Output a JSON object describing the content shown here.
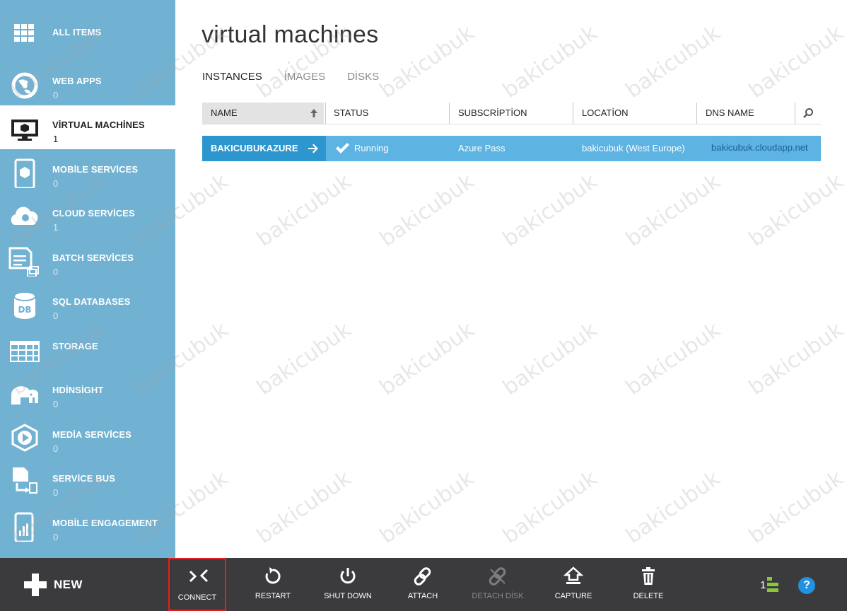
{
  "sidebar": {
    "items": [
      {
        "label": "ALL ITEMS",
        "count": "",
        "icon": "grid-icon"
      },
      {
        "label": "WEB APPS",
        "count": "0",
        "icon": "web-apps-icon"
      },
      {
        "label": "VİRTUAL MACHİNES",
        "count": "1",
        "icon": "monitor-icon"
      },
      {
        "label": "MOBİLE SERVİCES",
        "count": "0",
        "icon": "mobile-icon"
      },
      {
        "label": "CLOUD SERVİCES",
        "count": "1",
        "icon": "cloud-gear-icon"
      },
      {
        "label": "BATCH SERVİCES",
        "count": "0",
        "icon": "batch-icon"
      },
      {
        "label": "SQL DATABASES",
        "count": "0",
        "icon": "database-icon"
      },
      {
        "label": "STORAGE",
        "count": "",
        "icon": "table-icon"
      },
      {
        "label": "HDİNSİGHT",
        "count": "0",
        "icon": "elephant-icon"
      },
      {
        "label": "MEDİA SERVİCES",
        "count": "0",
        "icon": "media-play-icon"
      },
      {
        "label": "SERVİCE BUS",
        "count": "0",
        "icon": "service-bus-icon"
      },
      {
        "label": "MOBİLE ENGAGEMENT",
        "count": "0",
        "icon": "mobile-chart-icon"
      }
    ]
  },
  "main": {
    "title": "virtual machines",
    "tabs": [
      {
        "label": "INSTANCES",
        "active": true
      },
      {
        "label": "İMAGES",
        "active": false
      },
      {
        "label": "DİSKS",
        "active": false
      }
    ],
    "table": {
      "columns": [
        "NAME",
        "STATUS",
        "SUBSCRİPTİON",
        "LOCATİON",
        "DNS NAME"
      ],
      "rows": [
        {
          "name": "BAKICUBUKAZURE",
          "status": "Running",
          "subscription": "Azure Pass",
          "location": "bakicubuk (West Europe)",
          "dns": "bakicubuk.cloudapp.net"
        }
      ]
    }
  },
  "bottom_bar": {
    "new_label": "NEW",
    "commands": [
      {
        "label": "CONNECT",
        "enabled": true
      },
      {
        "label": "RESTART",
        "enabled": true
      },
      {
        "label": "SHUT DOWN",
        "enabled": true
      },
      {
        "label": "ATTACH",
        "enabled": true
      },
      {
        "label": "DETACH DİSK",
        "enabled": false
      },
      {
        "label": "CAPTURE",
        "enabled": true
      },
      {
        "label": "DELETE",
        "enabled": true
      }
    ],
    "notification_count": "1",
    "help_label": "?"
  },
  "watermark": "bakicubuk",
  "colors": {
    "sidebar": "#71b1d1",
    "selected_row": "#5db3e2",
    "selected_name_cell": "#2e96cf",
    "bottom_bar": "#3b3b3e",
    "highlight_border": "#e21e1e",
    "help_circle": "#2292e0",
    "notification_green": "#8cc63f"
  }
}
